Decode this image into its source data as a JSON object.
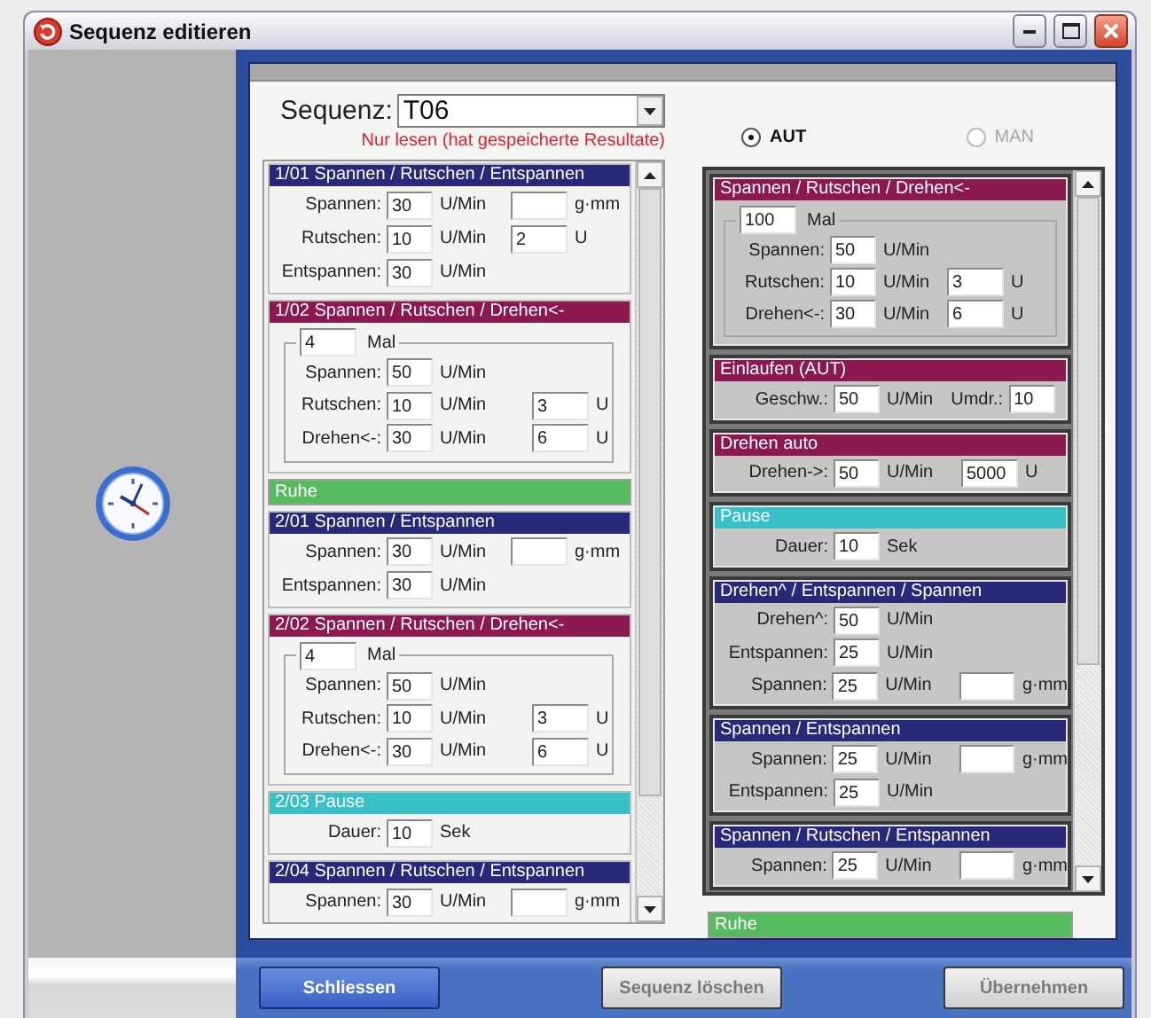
{
  "window": {
    "title": "Sequenz editieren"
  },
  "sequence": {
    "label": "Sequenz:",
    "value": "T06",
    "note": "Nur lesen (hat gespeicherte Resultate)"
  },
  "modes": [
    {
      "label": "AUT",
      "selected": true,
      "disabled": false
    },
    {
      "label": "MAN",
      "selected": false,
      "disabled": true
    }
  ],
  "left_steps": [
    {
      "kind": "step",
      "title": "1/01 Spannen / Rutschen / Entspannen",
      "color": "#29297a",
      "rows": [
        {
          "label": "Spannen:",
          "value": "30",
          "unit": "U/Min",
          "extra": {
            "unit": "g·mm"
          }
        },
        {
          "label": "Rutschen:",
          "value": "10",
          "unit": "U/Min",
          "extra": {
            "value": "2",
            "unit": "U"
          }
        },
        {
          "label": "Entspannen:",
          "value": "30",
          "unit": "U/Min"
        }
      ]
    },
    {
      "kind": "step",
      "title": "1/02 Spannen / Rutschen / Drehen<-",
      "color": "#8c1850",
      "loop": {
        "value": "4",
        "unit": "Mal"
      },
      "rows": [
        {
          "label": "Spannen:",
          "value": "50",
          "unit": "U/Min"
        },
        {
          "label": "Rutschen:",
          "value": "10",
          "unit": "U/Min",
          "extra": {
            "value": "3",
            "unit": "U"
          }
        },
        {
          "label": "Drehen<-:",
          "value": "30",
          "unit": "U/Min",
          "extra": {
            "value": "6",
            "unit": "U"
          }
        }
      ]
    },
    {
      "kind": "bar",
      "title": "Ruhe",
      "color": "#55bb5e"
    },
    {
      "kind": "step",
      "title": "2/01 Spannen / Entspannen",
      "color": "#29297a",
      "rows": [
        {
          "label": "Spannen:",
          "value": "30",
          "unit": "U/Min",
          "extra": {
            "unit": "g·mm"
          }
        },
        {
          "label": "Entspannen:",
          "value": "30",
          "unit": "U/Min"
        }
      ]
    },
    {
      "kind": "step",
      "title": "2/02 Spannen / Rutschen / Drehen<-",
      "color": "#8c1850",
      "loop": {
        "value": "4",
        "unit": "Mal"
      },
      "rows": [
        {
          "label": "Spannen:",
          "value": "50",
          "unit": "U/Min"
        },
        {
          "label": "Rutschen:",
          "value": "10",
          "unit": "U/Min",
          "extra": {
            "value": "3",
            "unit": "U"
          }
        },
        {
          "label": "Drehen<-:",
          "value": "30",
          "unit": "U/Min",
          "extra": {
            "value": "6",
            "unit": "U"
          }
        }
      ]
    },
    {
      "kind": "step",
      "title": "2/03 Pause",
      "color": "#38c0c8",
      "rows": [
        {
          "label": "Dauer:",
          "value": "10",
          "unit": "Sek"
        }
      ]
    },
    {
      "kind": "step",
      "title": "2/04 Spannen / Rutschen / Entspannen",
      "color": "#29297a",
      "rows": [
        {
          "label": "Spannen:",
          "value": "30",
          "unit": "U/Min",
          "extra": {
            "unit": "g·mm"
          }
        }
      ]
    }
  ],
  "right_steps": [
    {
      "kind": "step",
      "title": "Spannen / Rutschen / Drehen<-",
      "color": "#8c1850",
      "loop": {
        "value": "100",
        "unit": "Mal"
      },
      "rows": [
        {
          "label": "Spannen:",
          "value": "50",
          "unit": "U/Min"
        },
        {
          "label": "Rutschen:",
          "value": "10",
          "unit": "U/Min",
          "extra": {
            "value": "3",
            "unit": "U"
          }
        },
        {
          "label": "Drehen<-:",
          "value": "30",
          "unit": "U/Min",
          "extra": {
            "value": "6",
            "unit": "U"
          }
        }
      ]
    },
    {
      "kind": "step",
      "title": "Einlaufen (AUT)",
      "color": "#8c1850",
      "rows": [
        {
          "label": "Geschw.:",
          "value": "50",
          "unit": "U/Min",
          "label2": "Umdr.:",
          "value2": "10"
        }
      ]
    },
    {
      "kind": "step",
      "title": "Drehen auto",
      "color": "#8c1850",
      "rows": [
        {
          "label": "Drehen->:",
          "value": "50",
          "unit": "U/Min",
          "extra": {
            "value": "5000",
            "unit": "U"
          }
        }
      ]
    },
    {
      "kind": "step",
      "title": "Pause",
      "color": "#38c0c8",
      "rows": [
        {
          "label": "Dauer:",
          "value": "10",
          "unit": "Sek"
        }
      ]
    },
    {
      "kind": "step",
      "title": "Drehen^ / Entspannen / Spannen",
      "color": "#29297a",
      "rows": [
        {
          "label": "Drehen^:",
          "value": "50",
          "unit": "U/Min"
        },
        {
          "label": "Entspannen:",
          "value": "25",
          "unit": "U/Min"
        },
        {
          "label": "Spannen:",
          "value": "25",
          "unit": "U/Min",
          "extra": {
            "unit": "g·mm"
          }
        }
      ]
    },
    {
      "kind": "step",
      "title": "Spannen / Entspannen",
      "color": "#29297a",
      "rows": [
        {
          "label": "Spannen:",
          "value": "25",
          "unit": "U/Min",
          "extra": {
            "unit": "g·mm"
          }
        },
        {
          "label": "Entspannen:",
          "value": "25",
          "unit": "U/Min"
        }
      ]
    },
    {
      "kind": "step",
      "title": "Spannen / Rutschen / Entspannen",
      "color": "#29297a",
      "rows": [
        {
          "label": "Spannen:",
          "value": "25",
          "unit": "U/Min",
          "extra": {
            "unit": "g·mm"
          }
        }
      ]
    }
  ],
  "right_status": {
    "title": "Ruhe",
    "color": "#55bb5e"
  },
  "buttons": [
    {
      "label": "Schliessen",
      "kind": "primary",
      "disabled": false
    },
    {
      "label": "Sequenz löschen",
      "kind": "normal",
      "disabled": true
    },
    {
      "label": "Übernehmen",
      "kind": "normal",
      "disabled": true
    }
  ]
}
